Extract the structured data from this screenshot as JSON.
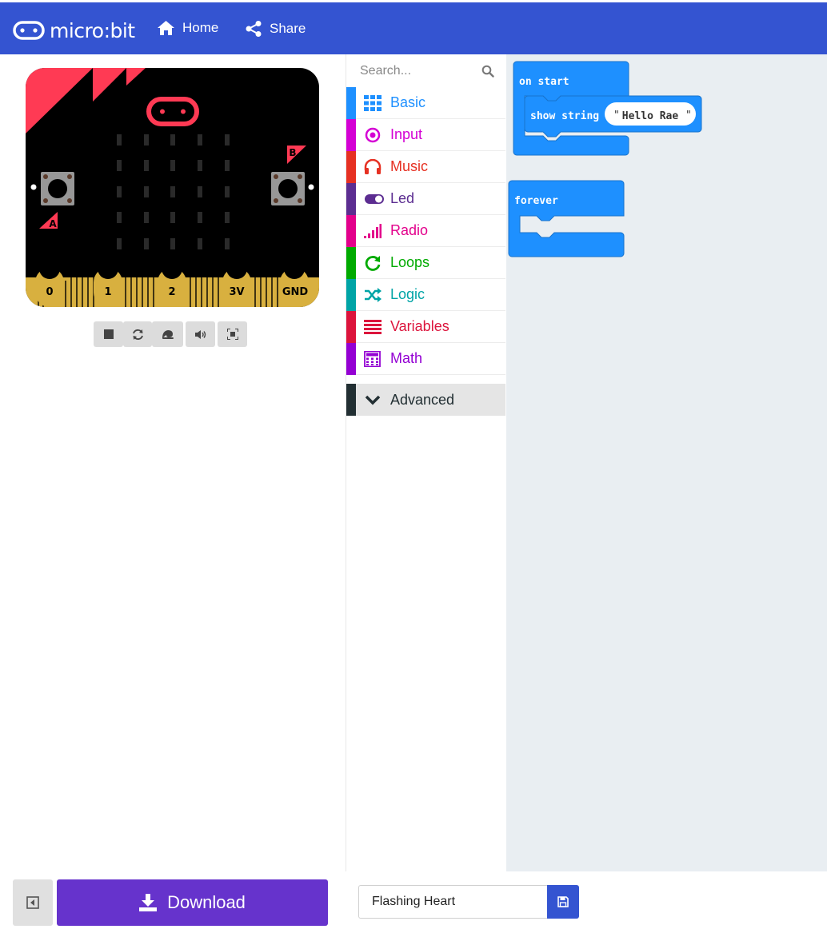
{
  "header": {
    "logo_text": "micro:bit",
    "nav": [
      {
        "label": "Home",
        "icon": "home-icon"
      },
      {
        "label": "Share",
        "icon": "share-icon"
      }
    ],
    "color": "#3454d1"
  },
  "simulator": {
    "board_color": "#000000",
    "accent_color": "#ff3a54",
    "pin_color": "#d8b03f",
    "button_a_label": "A",
    "button_b_label": "B",
    "pins": [
      "0",
      "1",
      "2",
      "3V",
      "GND"
    ],
    "controls": [
      "stop-icon",
      "restart-icon",
      "slow-motion-icon",
      "mute-icon",
      "fullscreen-icon"
    ]
  },
  "toolbox": {
    "search_placeholder": "Search...",
    "categories": [
      {
        "label": "Basic",
        "color": "#1e90ff",
        "icon": "grid-icon"
      },
      {
        "label": "Input",
        "color": "#d400d4",
        "icon": "radio-button-icon"
      },
      {
        "label": "Music",
        "color": "#e63022",
        "icon": "headphones-icon"
      },
      {
        "label": "Led",
        "color": "#5c2d91",
        "icon": "toggle-icon"
      },
      {
        "label": "Radio",
        "color": "#e3008c",
        "icon": "signal-bars-icon"
      },
      {
        "label": "Loops",
        "color": "#00aa00",
        "icon": "loop-icon"
      },
      {
        "label": "Logic",
        "color": "#00a4a6",
        "icon": "shuffle-icon"
      },
      {
        "label": "Variables",
        "color": "#dc143c",
        "icon": "lines-icon"
      },
      {
        "label": "Math",
        "color": "#9400d3",
        "icon": "calculator-icon"
      }
    ],
    "advanced": {
      "label": "Advanced",
      "color": "#222f33"
    }
  },
  "workspace": {
    "on_start_label": "on start",
    "show_string_label": "show string",
    "string_value": "Hello Rae",
    "forever_label": "forever",
    "block_color": "#1e90ff",
    "background": "#e9eef2"
  },
  "footer": {
    "download_label": "Download",
    "project_name": "Flashing Heart",
    "download_color": "#6633cc"
  }
}
